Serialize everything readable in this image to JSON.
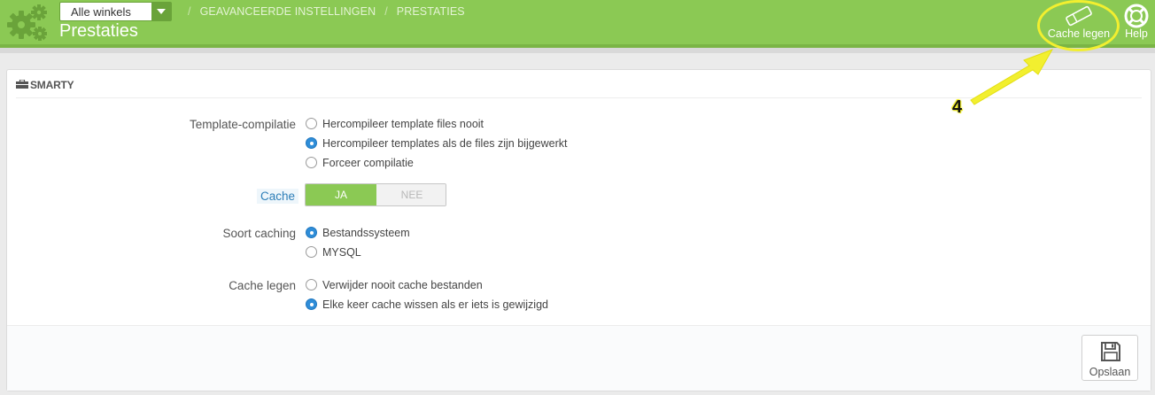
{
  "header": {
    "shop_select": "Alle winkels",
    "breadcrumb": [
      "GEAVANCEERDE INSTELLINGEN",
      "PRESTATIES"
    ],
    "breadcrumb_sep": "/",
    "title": "Prestaties",
    "cache_button": "Cache legen",
    "help_button": "Help"
  },
  "panel": {
    "heading": "SMARTY",
    "template_compilation": {
      "label": "Template-compilatie",
      "options": [
        {
          "label": "Hercompileer template files nooit",
          "selected": false
        },
        {
          "label": "Hercompileer templates als de files zijn bijgewerkt",
          "selected": true
        },
        {
          "label": "Forceer compilatie",
          "selected": false
        }
      ]
    },
    "cache": {
      "label": "Cache",
      "yes": "JA",
      "no": "NEE",
      "value": "JA"
    },
    "caching_type": {
      "label": "Soort caching",
      "options": [
        {
          "label": "Bestandssysteem",
          "selected": true
        },
        {
          "label": "MYSQL",
          "selected": false
        }
      ]
    },
    "clear_cache": {
      "label": "Cache legen",
      "options": [
        {
          "label": "Verwijder nooit cache bestanden",
          "selected": false
        },
        {
          "label": "Elke keer cache wissen als er iets is gewijzigd",
          "selected": true
        }
      ]
    },
    "save_button": "Opslaan"
  },
  "annotation": {
    "number": "4"
  },
  "colors": {
    "header_green": "#8bc954",
    "radio_selected": "#2f8dd8",
    "highlight_yellow": "#f2ef2f"
  },
  "icons": [
    "gears-icon",
    "eraser-icon",
    "lifebuoy-icon",
    "toolbox-icon",
    "save-icon",
    "caret-down-icon"
  ]
}
